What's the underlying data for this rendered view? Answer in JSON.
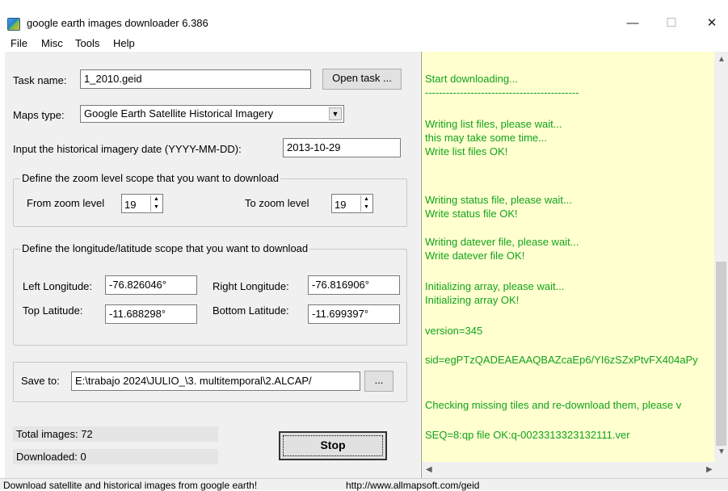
{
  "window": {
    "title": "google earth images downloader 6.386",
    "minimize": "—",
    "maximize": "☐",
    "close": "✕"
  },
  "menu": [
    "File",
    "Misc",
    "Tools",
    "Help"
  ],
  "task": {
    "label": "Task name:",
    "value": "1_2010.geid",
    "open_button": "Open task ..."
  },
  "maps_type": {
    "label": "Maps type:",
    "selected": "Google Earth Satellite Historical Imagery"
  },
  "date": {
    "label": "Input the  historical imagery date (YYYY-MM-DD):",
    "value": "2013-10-29"
  },
  "zoom": {
    "group_title": "Define the zoom level scope that you want to download",
    "from_label": "From zoom level",
    "from_value": "19",
    "to_label": "To zoom level",
    "to_value": "19"
  },
  "coords": {
    "group_title": "Define the longitude/latitude scope that you want to download",
    "left_lon_label": "Left Longitude:",
    "left_lon": "-76.826046°",
    "right_lon_label": "Right Longitude:",
    "right_lon": "-76.816906°",
    "top_lat_label": "Top Latitude:",
    "top_lat": "-11.688298°",
    "bottom_lat_label": "Bottom Latitude:",
    "bottom_lat": "-11.699397°"
  },
  "save": {
    "label": "Save to:",
    "value": "E:\\trabajo 2024\\JULIO_\\3. multitemporal\\2.ALCAP/",
    "browse": "..."
  },
  "stats": {
    "total": "Total images: 72",
    "downloaded": "Downloaded: 0"
  },
  "stop_button": "Stop",
  "log": [
    "Start downloading...",
    "--------------------------------------------",
    "Writing list files, please wait...",
    "this may take some time...",
    "Write list files OK!",
    "Writing status file, please wait...",
    "Write status file OK!",
    "Writing datever file, please wait...",
    "Write datever file OK!",
    "Initializing array, please wait...",
    "Initializing array OK!",
    "version=345",
    "sid=egPTzQADEAEAAQBAZcaEp6/YI6zSZxPtvFX404aPy",
    "Checking missing tiles and re-download them, please v",
    "SEQ=8:qp file OK:q-0023313323132111.ver"
  ],
  "statusbar": {
    "left": "Download satellite and historical  images from google earth!",
    "right": "http://www.allmapsoft.com/geid"
  },
  "colors": {
    "log_background": "#ffffd0",
    "log_text": "#11a31b",
    "panel": "#f0f0f0"
  }
}
